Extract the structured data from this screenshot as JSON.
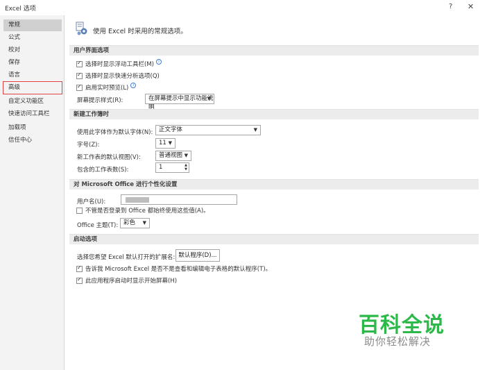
{
  "window": {
    "title": "Excel 选项",
    "help": "?",
    "close": "✕"
  },
  "sidebar": {
    "items": [
      {
        "label": "常规"
      },
      {
        "label": "公式"
      },
      {
        "label": "校对"
      },
      {
        "label": "保存"
      },
      {
        "label": "语言"
      },
      {
        "label": "高级"
      },
      {
        "label": "自定义功能区"
      },
      {
        "label": "快速访问工具栏"
      },
      {
        "label": "加载项"
      },
      {
        "label": "信任中心"
      }
    ]
  },
  "intro": "使用 Excel 时采用的常规选项。",
  "ui_section": {
    "header": "用户界面选项",
    "mini_toolbar": "选择时显示浮动工具栏(M)",
    "quick_analysis": "选择时显示快速分析选项(Q)",
    "live_preview": "启用实时预览(L)",
    "screentip_label": "屏幕提示样式(R):",
    "screentip_value": "在屏幕提示中显示功能说明"
  },
  "workbook_section": {
    "header": "新建工作簿时",
    "font_label": "使用此字体作为默认字体(N):",
    "font_value": "正文字体",
    "size_label": "字号(Z):",
    "size_value": "11",
    "view_label": "新工作表的默认视图(V):",
    "view_value": "普通视图",
    "sheets_label": "包含的工作表数(S):",
    "sheets_value": "1"
  },
  "personal_section": {
    "header": "对 Microsoft Office 进行个性化设置",
    "username_label": "用户名(U):",
    "always_use": "不管是否登录到 Office 都始终使用这些值(A)。",
    "theme_label": "Office 主题(T):",
    "theme_value": "彩色"
  },
  "startup_section": {
    "header": "启动选项",
    "extensions_label": "选择您希望 Excel 默认打开的扩展名:",
    "default_programs": "默认程序(D)...",
    "tell_me": "告诉我 Microsoft Excel 是否不是查看和编辑电子表格的默认程序(T)。",
    "show_start": "此应用程序启动时显示开始屏幕(H)"
  },
  "watermark": {
    "title": "百科全说",
    "subtitle": "助你轻松解决",
    "color": "#2db94a"
  },
  "checkbox_states": {
    "mini_toolbar": true,
    "quick_analysis": true,
    "live_preview": true,
    "always_use": false,
    "tell_me": true,
    "show_start": true
  }
}
